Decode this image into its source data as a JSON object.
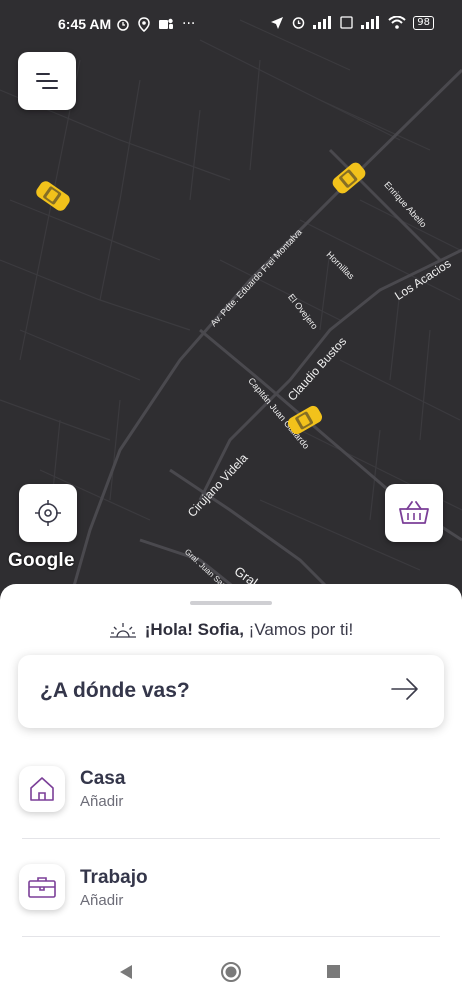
{
  "status_bar": {
    "time": "6:45 AM",
    "more": "···",
    "battery": "98"
  },
  "map": {
    "attribution": "Google",
    "streets": {
      "frei_montalva": "Av. Pdte. Eduardo Frei Montalva",
      "enrique_abello": "Enrique Abello",
      "hornillas": "Hornillas",
      "el_ovejero": "El Ovejero",
      "los_acacios": "Los Acacios",
      "claudio_bustos": "Claudio Bustos",
      "capitan_juan_gallardo": "Capitán Juan Gallardo",
      "cirujano_videla": "Cirujano Videla",
      "gral_juan_saavedra": "Gral. Juan Saavedra",
      "gral_e": "Gral. E"
    }
  },
  "sheet": {
    "greeting_bold": "¡Hola! Sofia,",
    "greeting_rest": "¡Vamos por ti!",
    "search_label": "¿A dónde vas?",
    "places": [
      {
        "title": "Casa",
        "subtitle": "Añadir"
      },
      {
        "title": "Trabajo",
        "subtitle": "Añadir"
      }
    ]
  },
  "colors": {
    "map_background": "#2f2e31",
    "taxi": "#f2c21b",
    "accent_purple": "#7b3f98",
    "text_dark": "#34364a"
  },
  "icons": [
    "menu-icon",
    "locate-icon",
    "basket-icon",
    "sunrise-icon",
    "arrow-right-icon",
    "home-icon",
    "briefcase-icon"
  ]
}
